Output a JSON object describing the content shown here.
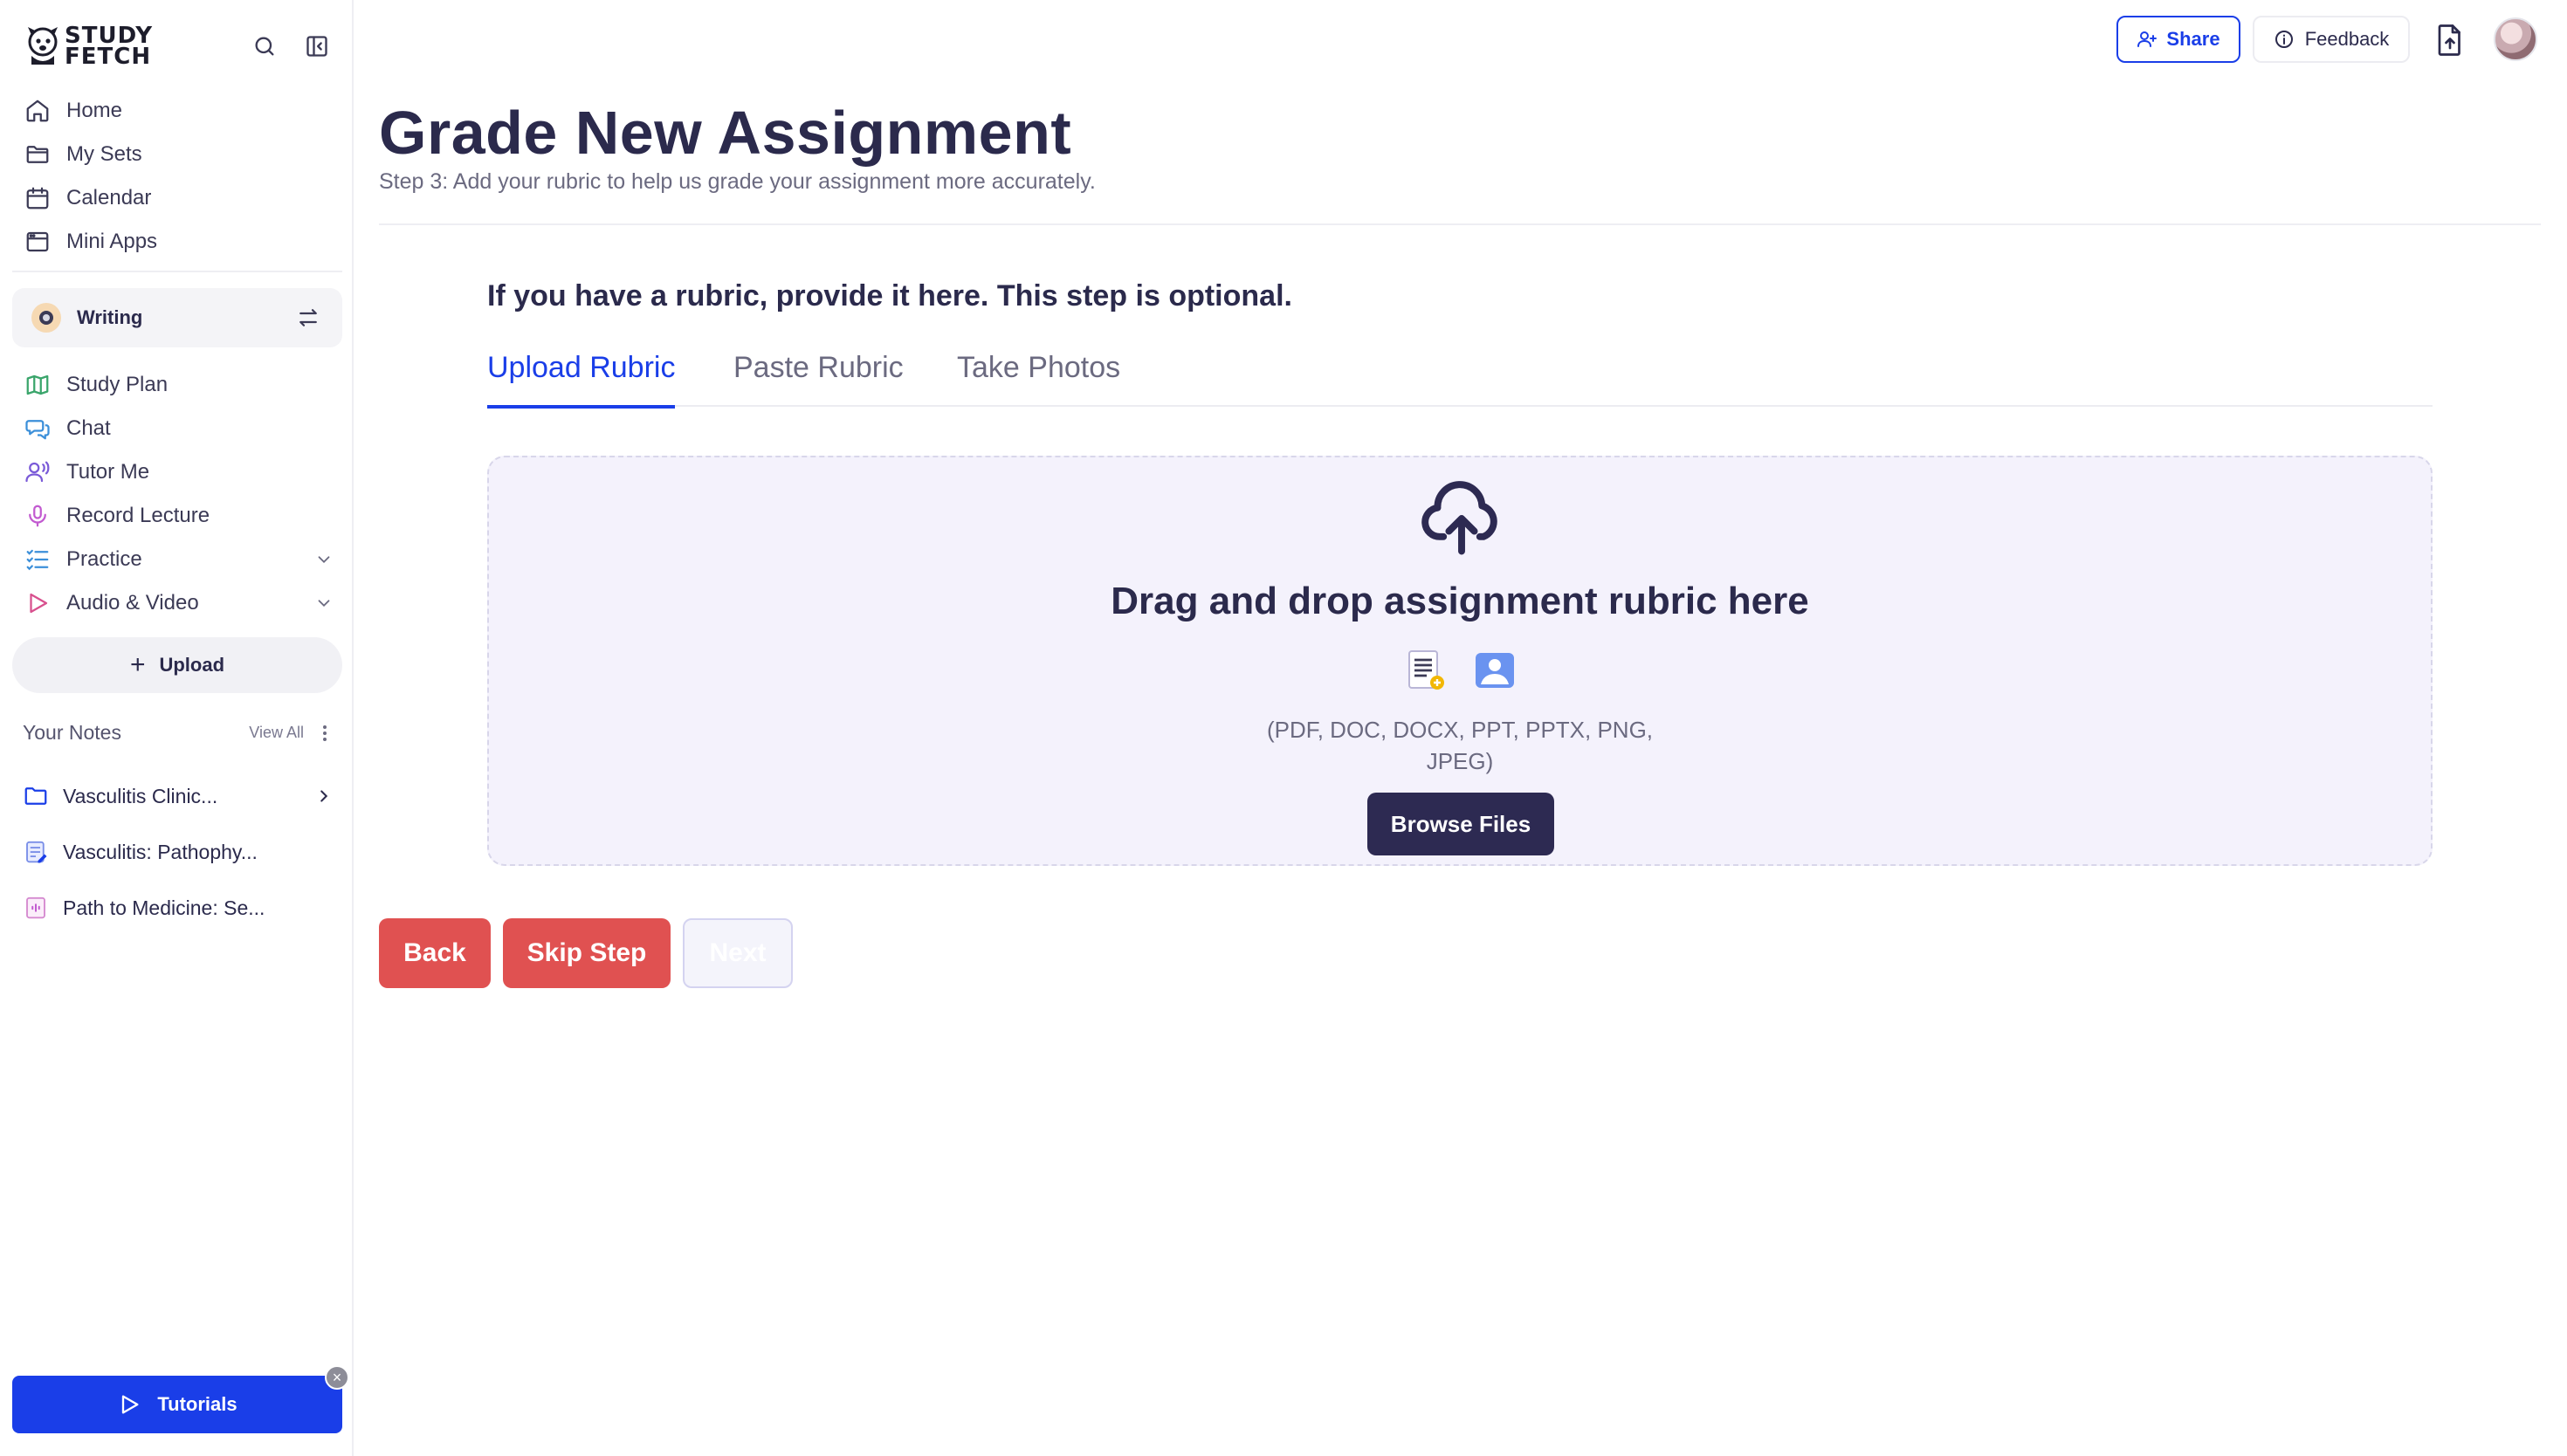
{
  "brand": {
    "name_line1": "STUDY",
    "name_line2": "FETCH"
  },
  "sidebar": {
    "nav": [
      {
        "label": "Home",
        "icon": "home-icon"
      },
      {
        "label": "My Sets",
        "icon": "folder-icon"
      },
      {
        "label": "Calendar",
        "icon": "calendar-icon"
      },
      {
        "label": "Mini Apps",
        "icon": "app-window-icon"
      }
    ],
    "workspace": {
      "label": "Writing"
    },
    "tools": [
      {
        "label": "Study Plan",
        "icon": "map-icon",
        "color": "#3aa56b"
      },
      {
        "label": "Chat",
        "icon": "chat-icon",
        "color": "#3b8fd9"
      },
      {
        "label": "Tutor Me",
        "icon": "tutor-icon",
        "color": "#7a5ad8"
      },
      {
        "label": "Record Lecture",
        "icon": "microphone-icon",
        "color": "#c25ad0"
      },
      {
        "label": "Practice",
        "icon": "checklist-icon",
        "color": "#3b8fd9"
      },
      {
        "label": "Audio & Video",
        "icon": "play-icon",
        "color": "#d8508e"
      }
    ],
    "upload_label": "Upload",
    "notes": {
      "title": "Your Notes",
      "view_all": "View All",
      "items": [
        {
          "label": "Vasculitis Clinic...",
          "icon": "folder-icon"
        },
        {
          "label": "Vasculitis: Pathophy...",
          "icon": "note-icon"
        },
        {
          "label": "Path to Medicine: Se...",
          "icon": "audio-note-icon"
        }
      ]
    },
    "tutorials_label": "Tutorials",
    "tutorials_close": "×"
  },
  "topbar": {
    "share_label": "Share",
    "feedback_label": "Feedback"
  },
  "page": {
    "title": "Grade New Assignment",
    "subtitle": "Step 3: Add your rubric to help us grade your assignment more accurately.",
    "prompt": "If you have a rubric, provide it here. This step is optional.",
    "tabs": [
      "Upload Rubric",
      "Paste Rubric",
      "Take Photos"
    ],
    "active_tab": 0,
    "dropzone": {
      "title": "Drag and drop assignment rubric here",
      "formats_line1": "(PDF, DOC, DOCX, PPT, PPTX, PNG,",
      "formats_line2": "JPEG)",
      "browse_label": "Browse Files"
    },
    "actions": {
      "back": "Back",
      "skip": "Skip Step",
      "next": "Next"
    }
  },
  "colors": {
    "accent": "#1a3ee8",
    "danger": "#e05151",
    "dark_button": "#2d2a52",
    "dropzone_bg": "#f4f2fc"
  }
}
